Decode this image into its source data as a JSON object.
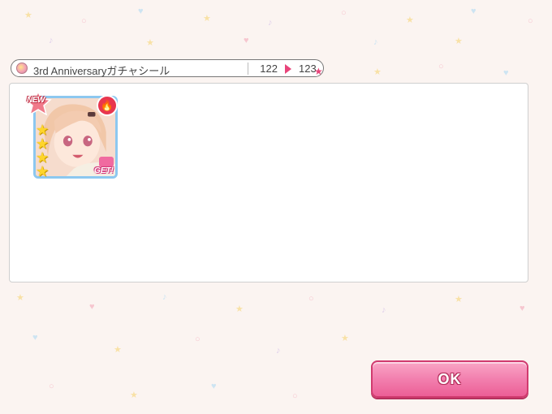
{
  "header": {
    "title": "3rd Anniversaryガチャシール",
    "level_from": "122",
    "level_to": "123"
  },
  "card": {
    "new_badge": "NEW",
    "get_badge": "GET!",
    "rarity_stars": 4,
    "attribute": "fire-icon",
    "frame_color": "#8cc8f0"
  },
  "actions": {
    "ok_label": "OK"
  },
  "colors": {
    "accent": "#e8447a",
    "button": "#f27fae",
    "background": "#fbf4f1"
  }
}
